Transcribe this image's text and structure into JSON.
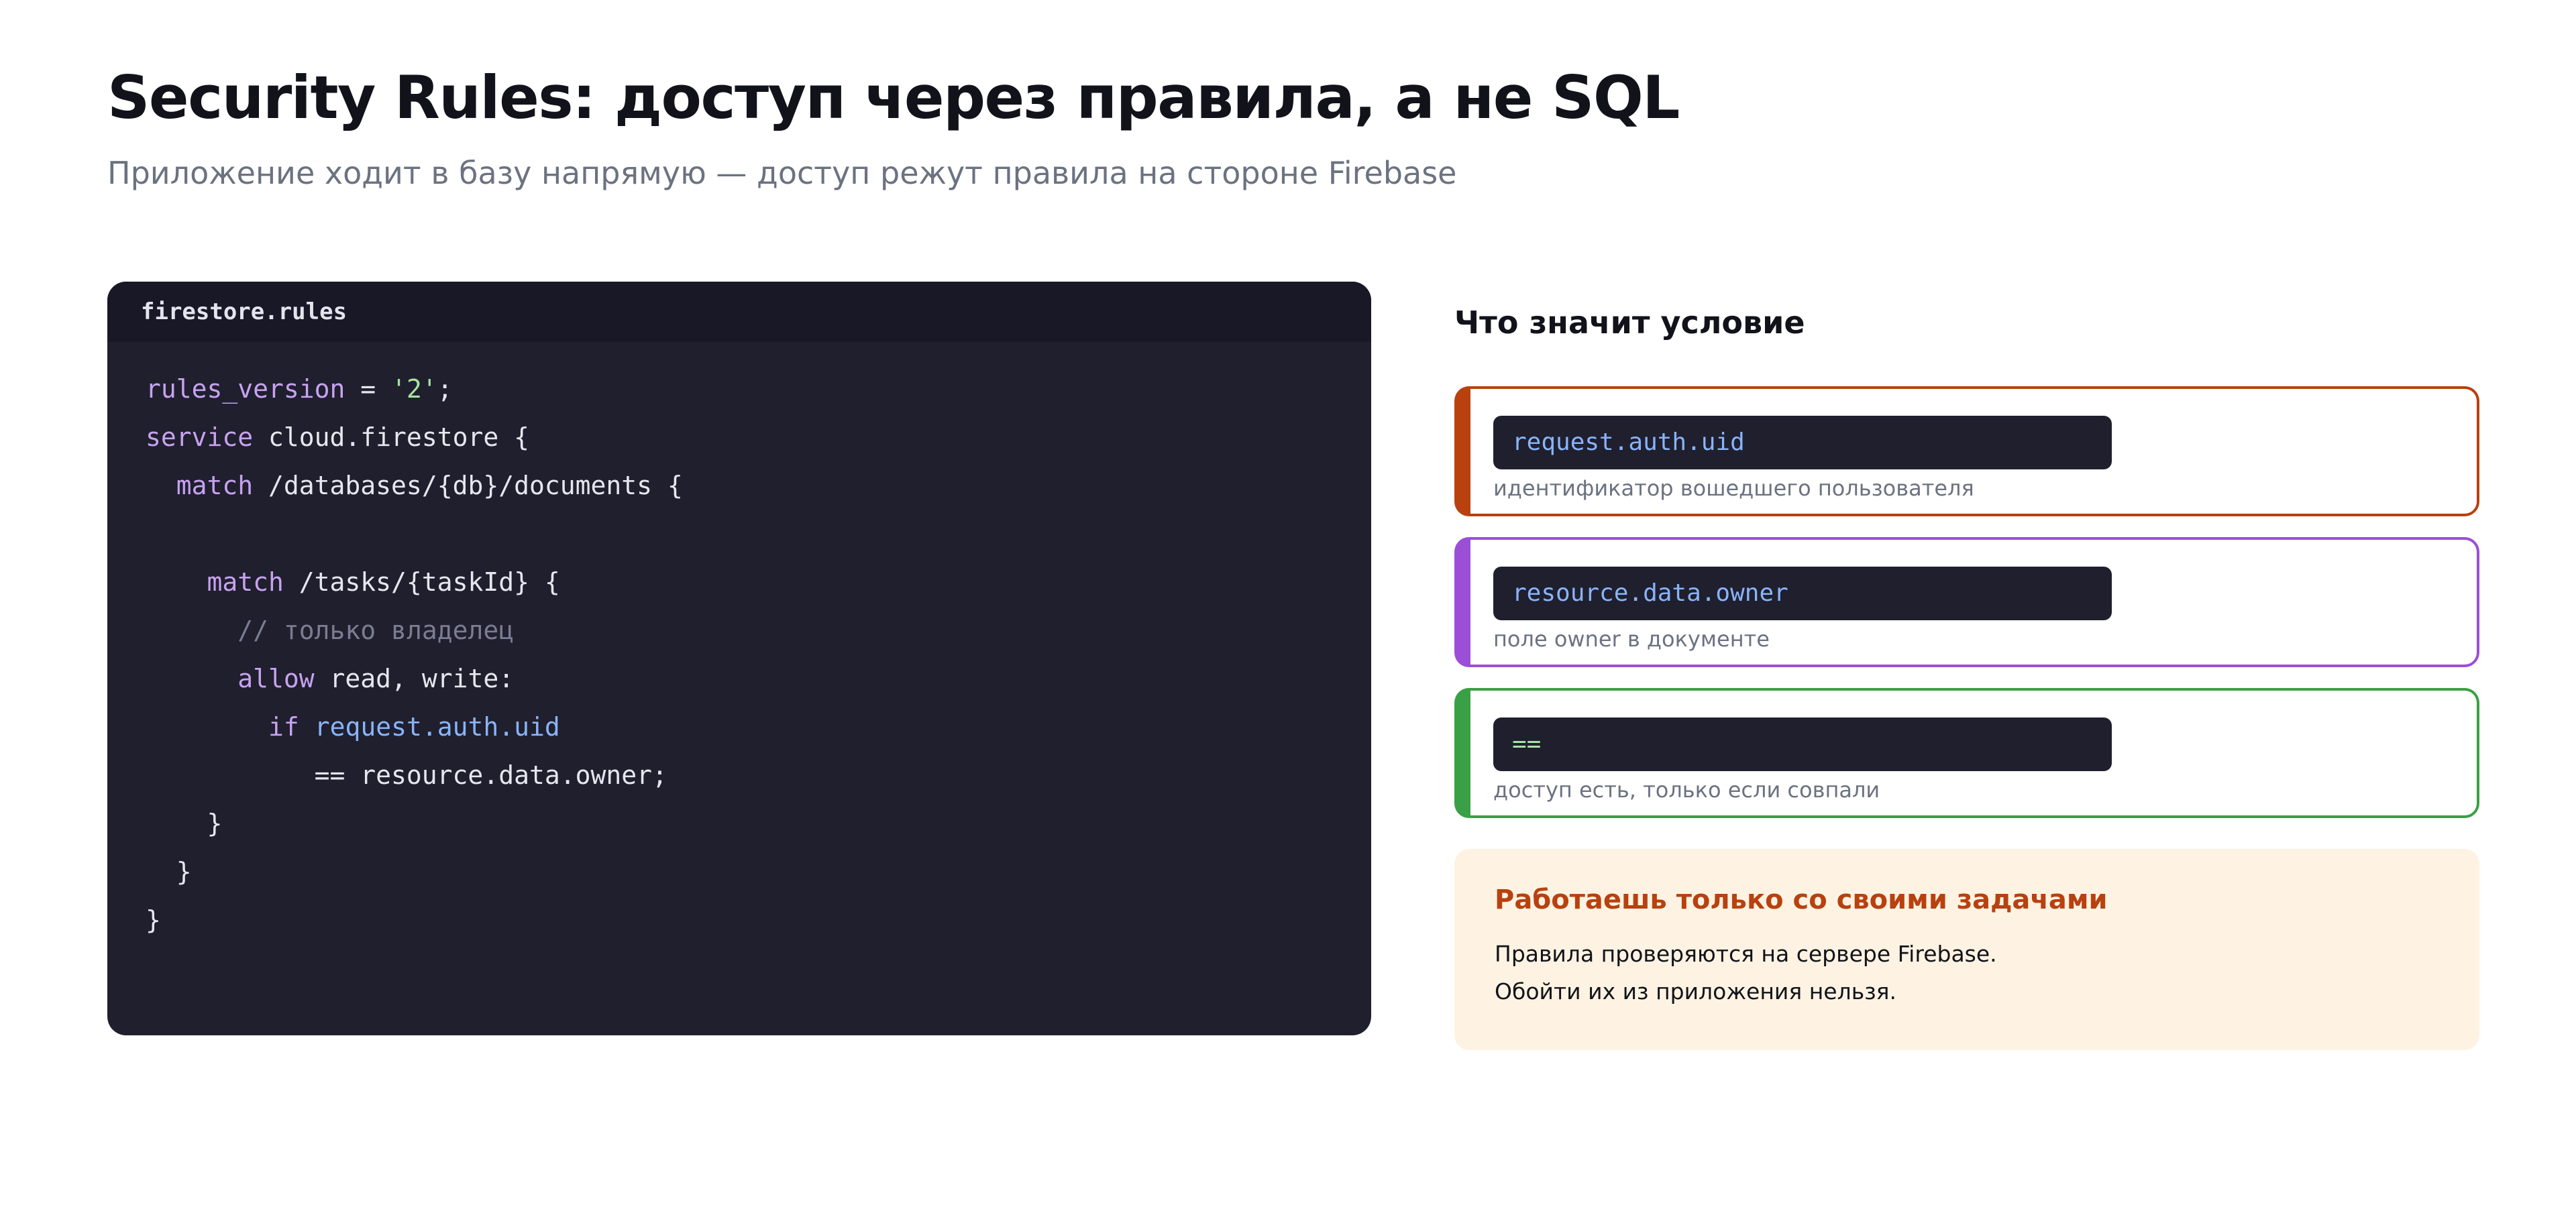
{
  "header": {
    "title": "Security Rules: доступ через правила, а не SQL",
    "subtitle": "Приложение ходит в базу напрямую — доступ режут правила на стороне Firebase"
  },
  "editor": {
    "filename": "firestore.rules",
    "lines": [
      [
        {
          "t": "kw",
          "v": "rules_version"
        },
        {
          "t": "plain",
          "v": " = "
        },
        {
          "t": "str",
          "v": "'2'"
        },
        {
          "t": "plain",
          "v": ";"
        }
      ],
      [
        {
          "t": "kw",
          "v": "service"
        },
        {
          "t": "plain",
          "v": " cloud.firestore {"
        }
      ],
      [
        {
          "t": "plain",
          "v": "  "
        },
        {
          "t": "kw",
          "v": "match"
        },
        {
          "t": "plain",
          "v": " /databases/{db}/documents {"
        }
      ],
      [],
      [
        {
          "t": "plain",
          "v": "    "
        },
        {
          "t": "kw",
          "v": "match"
        },
        {
          "t": "plain",
          "v": " /tasks/{taskId} {"
        }
      ],
      [
        {
          "t": "plain",
          "v": "      "
        },
        {
          "t": "cmt",
          "v": "// только владелец"
        }
      ],
      [
        {
          "t": "plain",
          "v": "      "
        },
        {
          "t": "kw",
          "v": "allow"
        },
        {
          "t": "plain",
          "v": " read, write:"
        }
      ],
      [
        {
          "t": "plain",
          "v": "        "
        },
        {
          "t": "kw",
          "v": "if"
        },
        {
          "t": "plain",
          "v": " "
        },
        {
          "t": "prop",
          "v": "request.auth.uid"
        }
      ],
      [
        {
          "t": "plain",
          "v": "           == resource.data.owner;"
        }
      ],
      [
        {
          "t": "plain",
          "v": "    }"
        }
      ],
      [
        {
          "t": "plain",
          "v": "  }"
        }
      ],
      [
        {
          "t": "plain",
          "v": "}"
        }
      ]
    ]
  },
  "conditions": {
    "heading": "Что значит условие",
    "items": [
      {
        "code": "request.auth.uid",
        "desc": "идентификатор вошедшего пользователя",
        "accent": "#b8410f",
        "code_color": "#89b4fa"
      },
      {
        "code": "resource.data.owner",
        "desc": "поле owner в документе",
        "accent": "#9b4fd6",
        "code_color": "#89b4fa"
      },
      {
        "code": "==",
        "desc": "доступ есть, только если совпали",
        "accent": "#3aa046",
        "code_color": "#a6e3a1"
      }
    ]
  },
  "note": {
    "title": "Работаешь только со своими задачами",
    "lines": [
      "Правила проверяются на сервере Firebase.",
      "Обойти их из приложения нельзя."
    ],
    "accent": "#b8410f",
    "background": "#fef3e2"
  }
}
